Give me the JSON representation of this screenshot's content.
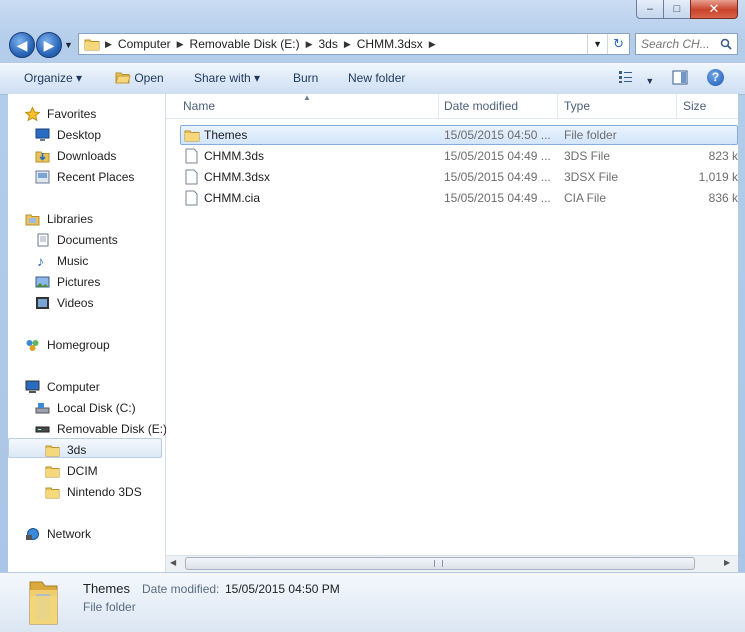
{
  "window": {
    "min_label": "–",
    "max_label": "□",
    "close_label": "✕"
  },
  "address": {
    "crumbs": [
      "Computer",
      "Removable Disk (E:)",
      "3ds",
      "CHMM.3dsx"
    ]
  },
  "search": {
    "placeholder": "Search CH..."
  },
  "toolbar": {
    "organize": "Organize ▾",
    "open": "Open",
    "share_with": "Share with ▾",
    "burn": "Burn",
    "new_folder": "New folder"
  },
  "nav": {
    "favorites": "Favorites",
    "desktop": "Desktop",
    "downloads": "Downloads",
    "recent_places": "Recent Places",
    "libraries": "Libraries",
    "documents": "Documents",
    "music": "Music",
    "pictures": "Pictures",
    "videos": "Videos",
    "homegroup": "Homegroup",
    "computer": "Computer",
    "local_disk": "Local Disk (C:)",
    "removable_disk": "Removable Disk (E:)",
    "folder_3ds": "3ds",
    "dcim": "DCIM",
    "nintendo_3ds": "Nintendo 3DS",
    "network": "Network"
  },
  "columns": {
    "name": "Name",
    "date_modified": "Date modified",
    "type": "Type",
    "size": "Size"
  },
  "files": [
    {
      "name": "Themes",
      "date": "15/05/2015 04:50 ...",
      "type": "File folder",
      "size": ""
    },
    {
      "name": "CHMM.3ds",
      "date": "15/05/2015 04:49 ...",
      "type": "3DS File",
      "size": "823 k"
    },
    {
      "name": "CHMM.3dsx",
      "date": "15/05/2015 04:49 ...",
      "type": "3DSX File",
      "size": "1,019 k"
    },
    {
      "name": "CHMM.cia",
      "date": "15/05/2015 04:49 ...",
      "type": "CIA File",
      "size": "836 k"
    }
  ],
  "details": {
    "name": "Themes",
    "date_label": "Date modified:",
    "date_value": "15/05/2015 04:50 PM",
    "type": "File folder"
  },
  "colors": {
    "accent": "#1e395b",
    "selection": "#d3e5fa",
    "link_blue": "#1e395b"
  },
  "icons": [
    "folder-icon",
    "file-icon",
    "star-icon",
    "desktop-icon",
    "computer-icon",
    "network-icon",
    "homegroup-icon",
    "music-icon",
    "pictures-icon",
    "videos-icon",
    "documents-icon",
    "help-icon",
    "view-icon",
    "preview-pane-icon"
  ]
}
